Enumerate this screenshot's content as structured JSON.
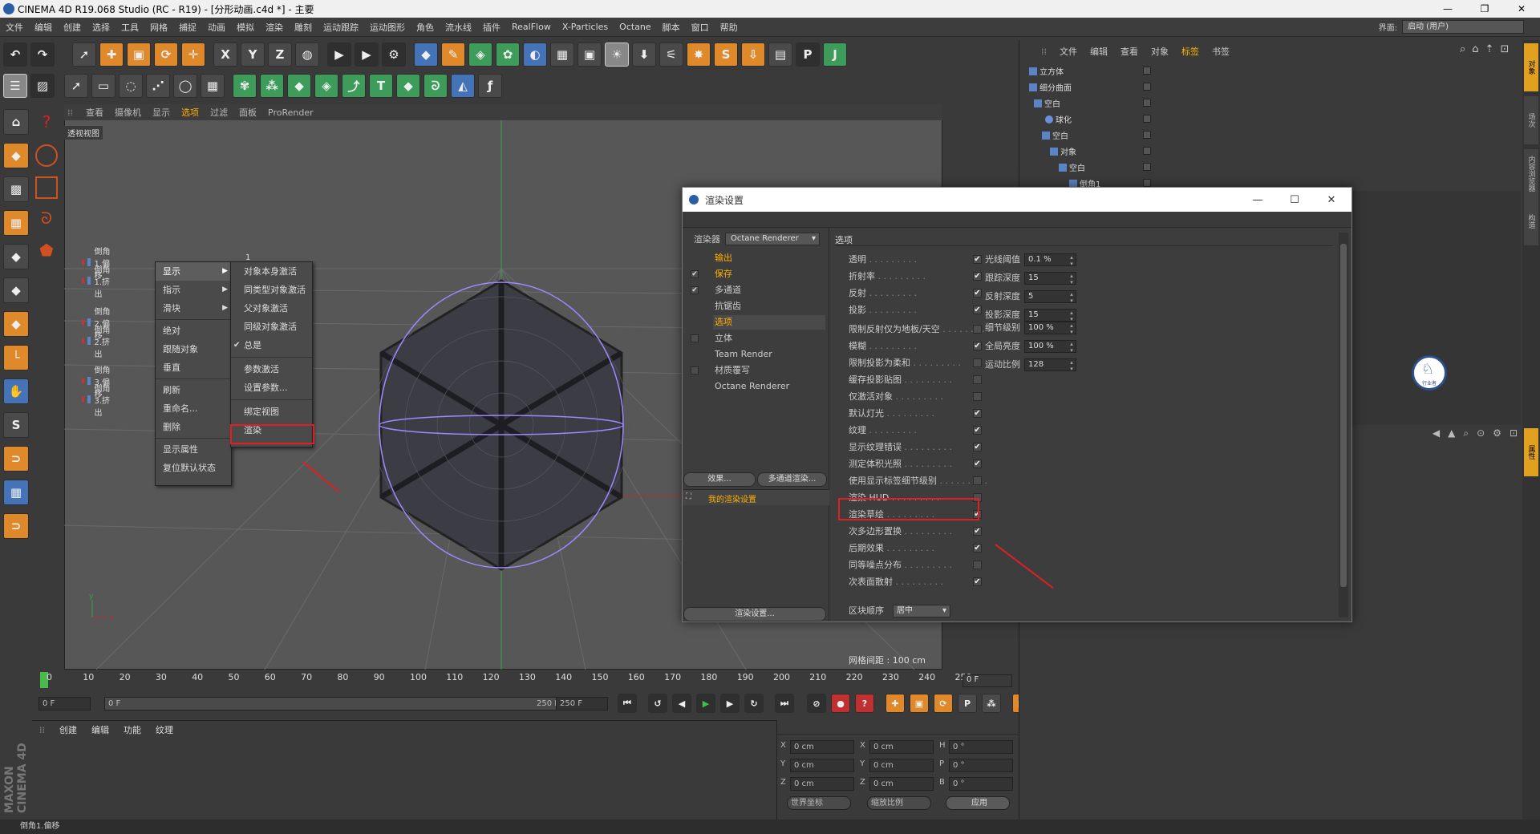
{
  "window": {
    "title": "CINEMA 4D R19.068 Studio (RC - R19) - [分形动画.c4d *] - 主要",
    "minimize": "—",
    "maximize": "❐",
    "close": "✕"
  },
  "menubar": {
    "items": [
      "文件",
      "编辑",
      "创建",
      "选择",
      "工具",
      "网格",
      "捕捉",
      "动画",
      "模拟",
      "渲染",
      "雕刻",
      "运动跟踪",
      "运动图形",
      "角色",
      "流水线",
      "插件",
      "RealFlow",
      "X-Particles",
      "Octane",
      "脚本",
      "窗口",
      "帮助"
    ],
    "layout_label": "界面:",
    "layout_value": "启动 (用户)"
  },
  "viewport": {
    "menu": [
      "查看",
      "摄像机",
      "显示",
      "选项",
      "过滤",
      "面板",
      "ProRender"
    ],
    "active_menu": "选项",
    "label": "透视视图",
    "grid_spacing": "网格间距 : 100 cm",
    "objects": [
      "倒角1.偏移",
      "倒角1.挤出",
      "倒角2.偏移",
      "倒角2.挤出",
      "倒角3.偏移",
      "倒角3.挤出"
    ],
    "objects_value": "1 %"
  },
  "context_menu": {
    "main": [
      "显示",
      "指示",
      "滑块",
      "绝对",
      "跟随对象",
      "垂直",
      "刷新",
      "重命名...",
      "删除",
      "显示属性",
      "复位默认状态"
    ],
    "sub": [
      "对象本身激活",
      "同类型对象激活",
      "父对象激活",
      "同级对象激活",
      "总是",
      "参数激活",
      "设置参数...",
      "绑定视图",
      "渲染"
    ]
  },
  "timeline": {
    "ticks": [
      "0",
      "10",
      "20",
      "30",
      "40",
      "50",
      "60",
      "70",
      "80",
      "90",
      "100",
      "110",
      "120",
      "130",
      "140",
      "150",
      "160",
      "170",
      "180",
      "190",
      "200",
      "210",
      "220",
      "230",
      "240",
      "250"
    ],
    "current": "0 F",
    "start": "0 F",
    "slider_start": "0 F",
    "slider_end": "250 F",
    "end": "250 F"
  },
  "material": {
    "menu": [
      "创建",
      "编辑",
      "功能",
      "纹理"
    ],
    "logo": "MAXON CINEMA 4D"
  },
  "coords": {
    "rows": [
      {
        "a": "X",
        "av": "0 cm",
        "b": "X",
        "bv": "0 cm",
        "c": "H",
        "cv": "0 °"
      },
      {
        "a": "Y",
        "av": "0 cm",
        "b": "Y",
        "bv": "0 cm",
        "c": "P",
        "cv": "0 °"
      },
      {
        "a": "Z",
        "av": "0 cm",
        "b": "Z",
        "bv": "0 cm",
        "c": "B",
        "cv": "0 °"
      }
    ],
    "mode1": "世界坐标",
    "mode2": "缩放比例",
    "apply": "应用"
  },
  "status": "倒角1.偏移",
  "object_manager": {
    "menu": [
      "文件",
      "编辑",
      "查看",
      "对象",
      "标签",
      "书签"
    ],
    "active_menu": "标签",
    "tree": [
      "立方体",
      "细分曲面",
      "空白",
      "球化",
      "空白",
      "对象",
      "空白",
      "倒角1"
    ]
  },
  "right_tabs": [
    "对象",
    "场次",
    "内容浏览器",
    "构造",
    "属性"
  ],
  "logo_text": "行业者",
  "dialog": {
    "title": "渲染设置",
    "renderer_label": "渲染器",
    "renderer_value": "Octane Renderer",
    "nav": [
      {
        "label": "输出",
        "checked": false,
        "active": true
      },
      {
        "label": "保存",
        "checked": true,
        "active": true
      },
      {
        "label": "多通道",
        "checked": true,
        "active": false
      },
      {
        "label": "抗锯齿",
        "checked": false,
        "active": false
      },
      {
        "label": "选项",
        "checked": false,
        "active": true
      },
      {
        "label": "立体",
        "checked": false,
        "active": false
      },
      {
        "label": "Team Render",
        "checked": false,
        "active": false
      },
      {
        "label": "材质覆写",
        "checked": false,
        "active": false
      },
      {
        "label": "Octane Renderer",
        "checked": false,
        "active": false
      }
    ],
    "effect_btn": "效果...",
    "multipass_btn": "多通道渲染...",
    "preset": "我的渲染设置",
    "render_settings_btn": "渲染设置...",
    "options_header": "选项",
    "options": [
      {
        "label": "透明",
        "checked": true
      },
      {
        "label": "折射率",
        "checked": true
      },
      {
        "label": "反射",
        "checked": true
      },
      {
        "label": "投影",
        "checked": true
      },
      {
        "label": "限制反射仅为地板/天空",
        "checked": false
      },
      {
        "label": "模糊",
        "checked": true
      },
      {
        "label": "限制投影为柔和",
        "checked": false
      },
      {
        "label": "缓存投影贴图",
        "checked": false
      },
      {
        "label": "仅激活对象",
        "checked": false
      },
      {
        "label": "默认灯光",
        "checked": true
      },
      {
        "label": "纹理",
        "checked": true
      },
      {
        "label": "显示纹理错误",
        "checked": true
      },
      {
        "label": "测定体积光照",
        "checked": true
      },
      {
        "label": "使用显示标签细节级别",
        "checked": false
      },
      {
        "label": "渲染 HUD",
        "checked": false
      },
      {
        "label": "渲染草绘",
        "checked": true
      },
      {
        "label": "次多边形置换",
        "checked": true
      },
      {
        "label": "后期效果",
        "checked": true
      },
      {
        "label": "同等噪点分布",
        "checked": false
      },
      {
        "label": "次表面散射",
        "checked": true
      }
    ],
    "bucket_label": "区块顺序",
    "bucket_value": "居中",
    "right_fields": [
      {
        "label": "光线阈值",
        "value": "0.1 %"
      },
      {
        "label": "跟踪深度",
        "value": "15"
      },
      {
        "label": "反射深度",
        "value": "5"
      },
      {
        "label": "投影深度",
        "value": "15"
      },
      {
        "label": "细节级别",
        "value": "100 %"
      },
      {
        "label": "全局亮度",
        "value": "100 %"
      },
      {
        "label": "运动比例",
        "value": "128"
      }
    ]
  }
}
